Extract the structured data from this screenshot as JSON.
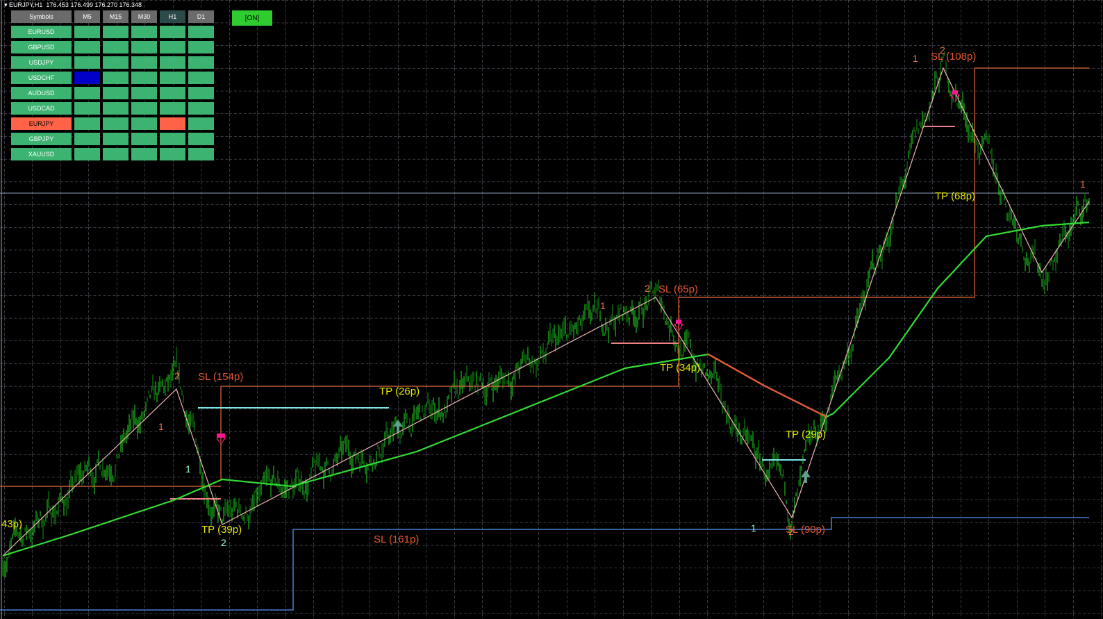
{
  "header": {
    "title": "EURJPY,H1",
    "ohlc": "176.453 176.499 176.270 176.348"
  },
  "panel": {
    "headers": [
      "Symbols",
      "M5",
      "M15",
      "M30",
      "H1",
      "D1"
    ],
    "rows": [
      {
        "symbol": "EURUSD",
        "cells": [
          "g",
          "g",
          "g",
          "g",
          "g"
        ]
      },
      {
        "symbol": "GBPUSD",
        "cells": [
          "g",
          "g",
          "g",
          "g",
          "g"
        ]
      },
      {
        "symbol": "USDJPY",
        "cells": [
          "g",
          "g",
          "g",
          "g",
          "g"
        ]
      },
      {
        "symbol": "USDCHF",
        "cells": [
          "b",
          "g",
          "g",
          "g",
          "g"
        ]
      },
      {
        "symbol": "AUDUSD",
        "cells": [
          "g",
          "g",
          "g",
          "g",
          "g"
        ]
      },
      {
        "symbol": "USDCAD",
        "cells": [
          "g",
          "g",
          "g",
          "g",
          "g"
        ]
      },
      {
        "symbol": "EURJPY",
        "cells": [
          "g",
          "g",
          "g",
          "r",
          "g"
        ],
        "selected": true
      },
      {
        "symbol": "GBPJPY",
        "cells": [
          "g",
          "g",
          "g",
          "g",
          "g"
        ]
      },
      {
        "symbol": "XAUUSD",
        "cells": [
          "g",
          "g",
          "g",
          "g",
          "g"
        ]
      }
    ],
    "colors": {
      "g": "#3cb371",
      "b": "#0000c8",
      "r": "#ff6347"
    },
    "toggle": "[ON]"
  },
  "labels": {
    "sl1": "SL (154p)",
    "tp1": "TP (26p)",
    "tp2": "TP (39p)",
    "sl2": "SL (161p)",
    "sl3": "SL (65p)",
    "tp3": "TP (34p)",
    "sl4": "SL (108p)",
    "tp4": "TP (68p)",
    "tp5": "TP (29p)",
    "sl5": "SL (90p)",
    "edge": "43p)",
    "one": "1",
    "two": "2"
  },
  "chart_data": {
    "type": "ohlc",
    "symbol": "EURJPY",
    "timeframe": "H1",
    "ylim": [
      175.122,
      176.904
    ],
    "bars": 784,
    "zigzag": [
      [
        2,
        175.304
      ],
      [
        127,
        175.784
      ],
      [
        160,
        175.394
      ],
      [
        472,
        176.048
      ],
      [
        570,
        175.414
      ],
      [
        679,
        176.708
      ],
      [
        750,
        176.12
      ],
      [
        784,
        176.324
      ]
    ],
    "moving_average": [
      [
        2,
        175.304
      ],
      [
        50,
        175.364
      ],
      [
        125,
        175.464
      ],
      [
        160,
        175.524
      ],
      [
        210,
        175.504
      ],
      [
        300,
        175.604
      ],
      [
        350,
        175.684
      ],
      [
        450,
        175.844
      ],
      [
        510,
        175.884
      ],
      [
        550,
        175.794
      ],
      [
        595,
        175.704
      ],
      [
        600,
        175.714
      ],
      [
        640,
        175.874
      ],
      [
        675,
        176.074
      ],
      [
        710,
        176.224
      ],
      [
        750,
        176.254
      ],
      [
        784,
        176.264
      ]
    ],
    "current_price": 176.348
  }
}
